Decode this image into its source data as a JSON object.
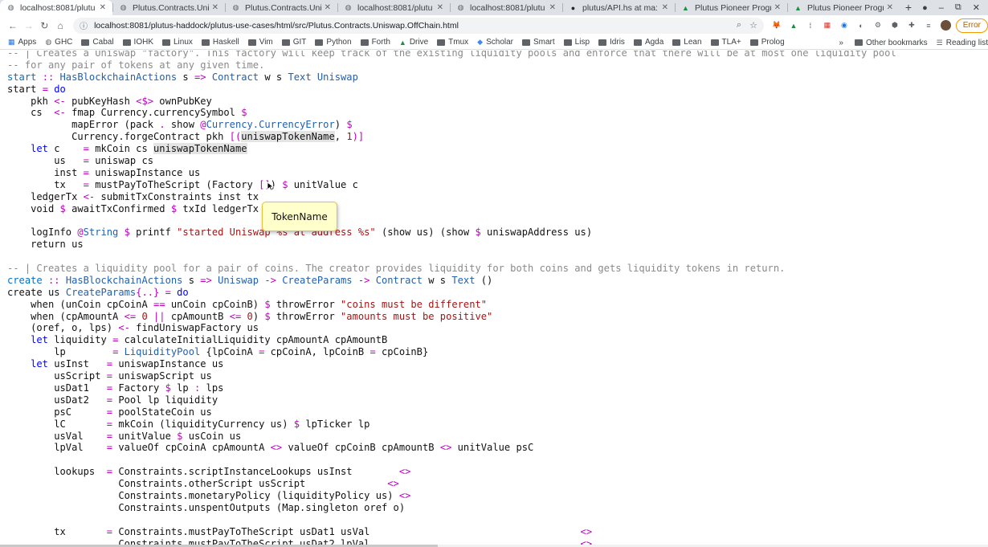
{
  "tabs": [
    {
      "title": "localhost:8081/plutu",
      "icon": "globe-icon",
      "active": true
    },
    {
      "title": "Plutus.Contracts.Unis",
      "icon": "globe-icon",
      "active": false
    },
    {
      "title": "Plutus.Contracts.Unis",
      "icon": "globe-icon",
      "active": false
    },
    {
      "title": "localhost:8081/plutu",
      "icon": "globe-icon",
      "active": false
    },
    {
      "title": "localhost:8081/plutu",
      "icon": "globe-icon",
      "active": false
    },
    {
      "title": "plutus/API.hs at ma:",
      "icon": "github-icon",
      "active": false
    },
    {
      "title": "Plutus Pioneer Progr",
      "icon": "drive-icon",
      "active": false
    },
    {
      "title": "Plutus Pioneer Progr",
      "icon": "drive-icon",
      "active": false
    }
  ],
  "new_tab": "+",
  "window": {
    "record": "●",
    "minimize": "–",
    "restore": "⧉",
    "close": "✕"
  },
  "toolbar": {
    "back": "←",
    "forward": "→",
    "reload": "↻",
    "home": "⌂",
    "info": "ⓘ",
    "url": "localhost:8081/plutus-haddock/plutus-use-cases/html/src/Plutus.Contracts.Uniswap.OffChain.html",
    "zoom_icon": "⌕",
    "star_icon": "☆",
    "error_label": "Error"
  },
  "extensions": [
    "fox-icon",
    "triangle-icon",
    "dot-icon",
    "grid-icon",
    "puzzle-circle-icon",
    "eye-icon",
    "gear-icon",
    "cube-icon",
    "puzzle-icon",
    "list-icon"
  ],
  "bookmarks": {
    "items": [
      {
        "label": "Apps",
        "kind": "apps"
      },
      {
        "label": "GHC",
        "kind": "globe"
      },
      {
        "label": "Cabal",
        "kind": "folder"
      },
      {
        "label": "IOHK",
        "kind": "folder"
      },
      {
        "label": "Linux",
        "kind": "folder"
      },
      {
        "label": "Haskell",
        "kind": "folder"
      },
      {
        "label": "Vim",
        "kind": "folder"
      },
      {
        "label": "GIT",
        "kind": "folder"
      },
      {
        "label": "Python",
        "kind": "folder"
      },
      {
        "label": "Forth",
        "kind": "folder"
      },
      {
        "label": "Drive",
        "kind": "drive"
      },
      {
        "label": "Tmux",
        "kind": "folder"
      },
      {
        "label": "Scholar",
        "kind": "scholar"
      },
      {
        "label": "Smart",
        "kind": "folder"
      },
      {
        "label": "Lisp",
        "kind": "folder"
      },
      {
        "label": "Idris",
        "kind": "folder"
      },
      {
        "label": "Agda",
        "kind": "folder"
      },
      {
        "label": "Lean",
        "kind": "folder"
      },
      {
        "label": "TLA+",
        "kind": "folder"
      },
      {
        "label": "Prolog",
        "kind": "folder"
      }
    ],
    "more": "»",
    "other": "Other bookmarks",
    "reading": "Reading list"
  },
  "tooltip": "TokenName",
  "code_lines": [
    [
      [
        "c",
        "-- | Creates a Uniswap \"factory\". This factory will keep track of the existing liquidity pools and enforce that there will be at most one liquidity pool"
      ]
    ],
    [
      [
        "c",
        "-- for any pair of tokens at any given time."
      ]
    ],
    [
      [
        "n",
        "start"
      ],
      [
        "p",
        " "
      ],
      [
        "op",
        "::"
      ],
      [
        "p",
        " "
      ],
      [
        "t",
        "HasBlockchainActions"
      ],
      [
        "p",
        " s "
      ],
      [
        "op",
        "=>"
      ],
      [
        "p",
        " "
      ],
      [
        "t",
        "Contract"
      ],
      [
        "p",
        " w s "
      ],
      [
        "t",
        "Text"
      ],
      [
        "p",
        " "
      ],
      [
        "t",
        "Uniswap"
      ]
    ],
    [
      [
        "p",
        "start "
      ],
      [
        "op",
        "="
      ],
      [
        "p",
        " "
      ],
      [
        "k",
        "do"
      ]
    ],
    [
      [
        "p",
        "    pkh "
      ],
      [
        "op",
        "<-"
      ],
      [
        "p",
        " pubKeyHash "
      ],
      [
        "op",
        "<$>"
      ],
      [
        "p",
        " ownPubKey"
      ]
    ],
    [
      [
        "p",
        "    cs  "
      ],
      [
        "op",
        "<-"
      ],
      [
        "p",
        " fmap Currency.currencySymbol "
      ],
      [
        "op",
        "$"
      ]
    ],
    [
      [
        "p",
        "           mapError (pack "
      ],
      [
        "op",
        "."
      ],
      [
        "p",
        " show "
      ],
      [
        "op",
        "@"
      ],
      [
        "t",
        "Currency.CurrencyError"
      ],
      [
        "p",
        ") "
      ],
      [
        "op",
        "$"
      ]
    ],
    [
      [
        "p",
        "           Currency.forgeContract pkh "
      ],
      [
        "op",
        "[("
      ],
      [
        "h",
        "uniswapTokenName"
      ],
      [
        "p",
        ", "
      ],
      [
        "s",
        "1"
      ],
      [
        "op",
        ")]"
      ]
    ],
    [
      [
        "p",
        "    "
      ],
      [
        "k",
        "let"
      ],
      [
        "p",
        " c    "
      ],
      [
        "op",
        "="
      ],
      [
        "p",
        " mkCoin cs "
      ],
      [
        "h",
        "uniswapTokenName"
      ]
    ],
    [
      [
        "p",
        "        us   "
      ],
      [
        "op",
        "="
      ],
      [
        "p",
        " uniswap cs"
      ]
    ],
    [
      [
        "p",
        "        inst "
      ],
      [
        "op",
        "="
      ],
      [
        "p",
        " uniswapInstance us"
      ]
    ],
    [
      [
        "p",
        "        tx   "
      ],
      [
        "op",
        "="
      ],
      [
        "p",
        " mustPayToTheScript (Factory "
      ],
      [
        "op",
        "[]"
      ],
      [
        "p",
        ") "
      ],
      [
        "op",
        "$"
      ],
      [
        "p",
        " unitValue c"
      ]
    ],
    [
      [
        "p",
        "    ledgerTx "
      ],
      [
        "op",
        "<-"
      ],
      [
        "p",
        " submitTxConstraints inst tx"
      ]
    ],
    [
      [
        "p",
        "    void "
      ],
      [
        "op",
        "$"
      ],
      [
        "p",
        " awaitTxConfirmed "
      ],
      [
        "op",
        "$"
      ],
      [
        "p",
        " txId ledgerTx"
      ]
    ],
    [
      [
        "p",
        ""
      ]
    ],
    [
      [
        "p",
        "    logInfo "
      ],
      [
        "op",
        "@"
      ],
      [
        "t",
        "String"
      ],
      [
        "p",
        " "
      ],
      [
        "op",
        "$"
      ],
      [
        "p",
        " printf "
      ],
      [
        "s",
        "\"started Uniswap %s at address %s\""
      ],
      [
        "p",
        " (show us) (show "
      ],
      [
        "op",
        "$"
      ],
      [
        "p",
        " uniswapAddress us)"
      ]
    ],
    [
      [
        "p",
        "    return us"
      ]
    ],
    [
      [
        "p",
        ""
      ]
    ],
    [
      [
        "c",
        "-- | Creates a liquidity pool for a pair of coins. The creator provides liquidity for both coins and gets liquidity tokens in return."
      ]
    ],
    [
      [
        "n",
        "create"
      ],
      [
        "p",
        " "
      ],
      [
        "op",
        "::"
      ],
      [
        "p",
        " "
      ],
      [
        "t",
        "HasBlockchainActions"
      ],
      [
        "p",
        " s "
      ],
      [
        "op",
        "=>"
      ],
      [
        "p",
        " "
      ],
      [
        "t",
        "Uniswap"
      ],
      [
        "p",
        " "
      ],
      [
        "op",
        "->"
      ],
      [
        "p",
        " "
      ],
      [
        "t",
        "CreateParams"
      ],
      [
        "p",
        " "
      ],
      [
        "op",
        "->"
      ],
      [
        "p",
        " "
      ],
      [
        "t",
        "Contract"
      ],
      [
        "p",
        " w s "
      ],
      [
        "t",
        "Text"
      ],
      [
        "p",
        " ()"
      ]
    ],
    [
      [
        "p",
        "create us "
      ],
      [
        "t",
        "CreateParams"
      ],
      [
        "op",
        "{..}"
      ],
      [
        "p",
        " "
      ],
      [
        "op",
        "="
      ],
      [
        "p",
        " "
      ],
      [
        "k",
        "do"
      ]
    ],
    [
      [
        "p",
        "    when (unCoin cpCoinA "
      ],
      [
        "op",
        "=="
      ],
      [
        "p",
        " unCoin cpCoinB) "
      ],
      [
        "op",
        "$"
      ],
      [
        "p",
        " throwError "
      ],
      [
        "s",
        "\"coins must be different\""
      ]
    ],
    [
      [
        "p",
        "    when (cpAmountA "
      ],
      [
        "op",
        "<="
      ],
      [
        "p",
        " "
      ],
      [
        "s",
        "0"
      ],
      [
        "p",
        " "
      ],
      [
        "op",
        "||"
      ],
      [
        "p",
        " cpAmountB "
      ],
      [
        "op",
        "<="
      ],
      [
        "p",
        " "
      ],
      [
        "s",
        "0"
      ],
      [
        "p",
        ") "
      ],
      [
        "op",
        "$"
      ],
      [
        "p",
        " throwError "
      ],
      [
        "s",
        "\"amounts must be positive\""
      ]
    ],
    [
      [
        "p",
        "    (oref, o, lps) "
      ],
      [
        "op",
        "<-"
      ],
      [
        "p",
        " findUniswapFactory us"
      ]
    ],
    [
      [
        "p",
        "    "
      ],
      [
        "k",
        "let"
      ],
      [
        "p",
        " liquidity "
      ],
      [
        "op",
        "="
      ],
      [
        "p",
        " calculateInitialLiquidity cpAmountA cpAmountB"
      ]
    ],
    [
      [
        "p",
        "        lp        "
      ],
      [
        "op",
        "="
      ],
      [
        "p",
        " "
      ],
      [
        "t",
        "LiquidityPool"
      ],
      [
        "p",
        " {lpCoinA "
      ],
      [
        "op",
        "="
      ],
      [
        "p",
        " cpCoinA, lpCoinB "
      ],
      [
        "op",
        "="
      ],
      [
        "p",
        " cpCoinB}"
      ]
    ],
    [
      [
        "p",
        "    "
      ],
      [
        "k",
        "let"
      ],
      [
        "p",
        " usInst   "
      ],
      [
        "op",
        "="
      ],
      [
        "p",
        " uniswapInstance us"
      ]
    ],
    [
      [
        "p",
        "        usScript "
      ],
      [
        "op",
        "="
      ],
      [
        "p",
        " uniswapScript us"
      ]
    ],
    [
      [
        "p",
        "        usDat1   "
      ],
      [
        "op",
        "="
      ],
      [
        "p",
        " Factory "
      ],
      [
        "op",
        "$"
      ],
      [
        "p",
        " lp "
      ],
      [
        "op",
        ":"
      ],
      [
        "p",
        " lps"
      ]
    ],
    [
      [
        "p",
        "        usDat2   "
      ],
      [
        "op",
        "="
      ],
      [
        "p",
        " Pool lp liquidity"
      ]
    ],
    [
      [
        "p",
        "        psC      "
      ],
      [
        "op",
        "="
      ],
      [
        "p",
        " poolStateCoin us"
      ]
    ],
    [
      [
        "p",
        "        lC       "
      ],
      [
        "op",
        "="
      ],
      [
        "p",
        " mkCoin (liquidityCurrency us) "
      ],
      [
        "op",
        "$"
      ],
      [
        "p",
        " lpTicker lp"
      ]
    ],
    [
      [
        "p",
        "        usVal    "
      ],
      [
        "op",
        "="
      ],
      [
        "p",
        " unitValue "
      ],
      [
        "op",
        "$"
      ],
      [
        "p",
        " usCoin us"
      ]
    ],
    [
      [
        "p",
        "        lpVal    "
      ],
      [
        "op",
        "="
      ],
      [
        "p",
        " valueOf cpCoinA cpAmountA "
      ],
      [
        "op",
        "<>"
      ],
      [
        "p",
        " valueOf cpCoinB cpAmountB "
      ],
      [
        "op",
        "<>"
      ],
      [
        "p",
        " unitValue psC"
      ]
    ],
    [
      [
        "p",
        ""
      ]
    ],
    [
      [
        "p",
        "        lookups  "
      ],
      [
        "op",
        "="
      ],
      [
        "p",
        " Constraints.scriptInstanceLookups usInst        "
      ],
      [
        "op",
        "<>"
      ]
    ],
    [
      [
        "p",
        "                   Constraints.otherScript usScript              "
      ],
      [
        "op",
        "<>"
      ]
    ],
    [
      [
        "p",
        "                   Constraints.monetaryPolicy (liquidityPolicy us) "
      ],
      [
        "op",
        "<>"
      ]
    ],
    [
      [
        "p",
        "                   Constraints.unspentOutputs (Map.singleton oref o)"
      ]
    ],
    [
      [
        "p",
        ""
      ]
    ],
    [
      [
        "p",
        "        tx       "
      ],
      [
        "op",
        "="
      ],
      [
        "p",
        " Constraints.mustPayToTheScript usDat1 usVal                                    "
      ],
      [
        "op",
        "<>"
      ]
    ],
    [
      [
        "p",
        "                   Constraints.mustPayToTheScript usDat2 lpVal                                    "
      ],
      [
        "op",
        "<>"
      ]
    ]
  ]
}
